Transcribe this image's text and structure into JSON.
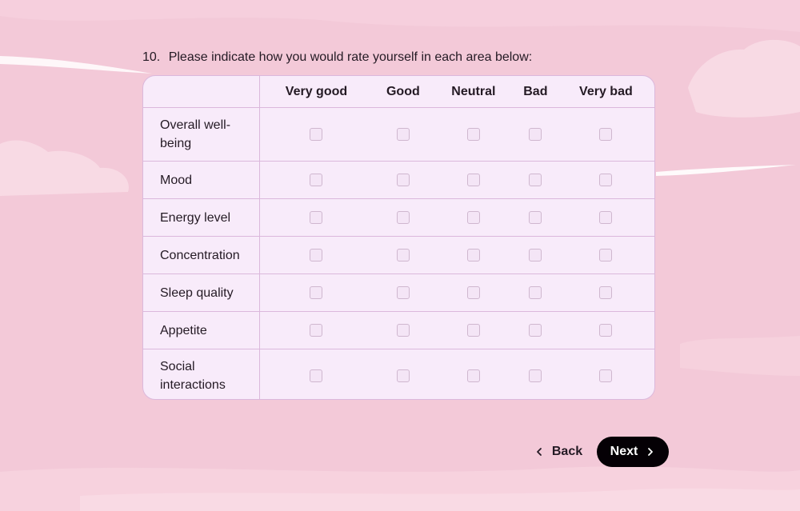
{
  "question": {
    "number": "10.",
    "text": "Please indicate how you would rate yourself in each area below:"
  },
  "grid": {
    "columns": [
      "Very good",
      "Good",
      "Neutral",
      "Bad",
      "Very bad"
    ],
    "rows": [
      "Overall well-being",
      "Mood",
      "Energy level",
      "Concentration",
      "Sleep quality",
      "Appetite",
      "Social interactions"
    ]
  },
  "navigation": {
    "back_label": "Back",
    "next_label": "Next",
    "back_icon": "chevron-left-icon",
    "next_icon": "chevron-right-icon"
  },
  "colors": {
    "background": "#f3c9d8",
    "card": "#f8ebfa",
    "border": "#dbb8dc",
    "next_button": "#050005"
  }
}
